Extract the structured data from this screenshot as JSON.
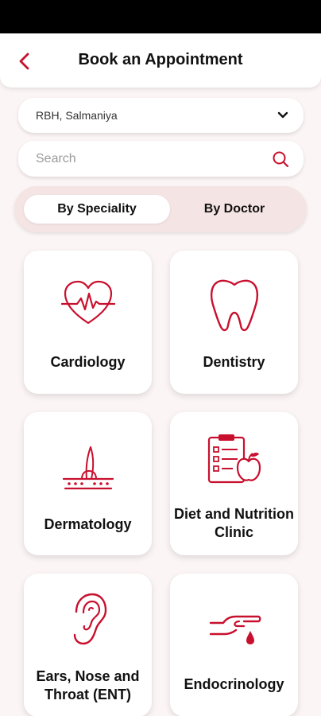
{
  "header": {
    "title": "Book an Appointment"
  },
  "location": {
    "selected": "RBH, Salmaniya"
  },
  "search": {
    "placeholder": "Search",
    "value": ""
  },
  "tabs": [
    {
      "label": "By Speciality",
      "active": true
    },
    {
      "label": "By Doctor",
      "active": false
    }
  ],
  "specialities": [
    {
      "label": "Cardiology",
      "icon": "heart-pulse-icon"
    },
    {
      "label": "Dentistry",
      "icon": "tooth-icon"
    },
    {
      "label": "Dermatology",
      "icon": "skin-hair-icon"
    },
    {
      "label": "Diet and Nutrition Clinic",
      "icon": "diet-clipboard-apple-icon"
    },
    {
      "label": "Ears, Nose and Throat (ENT)",
      "icon": "ear-icon"
    },
    {
      "label": "Endocrinology",
      "icon": "hand-drop-icon"
    }
  ],
  "colors": {
    "accent": "#c8102e",
    "background": "#fcf5f5",
    "segment_bg": "#f5e4e4"
  }
}
